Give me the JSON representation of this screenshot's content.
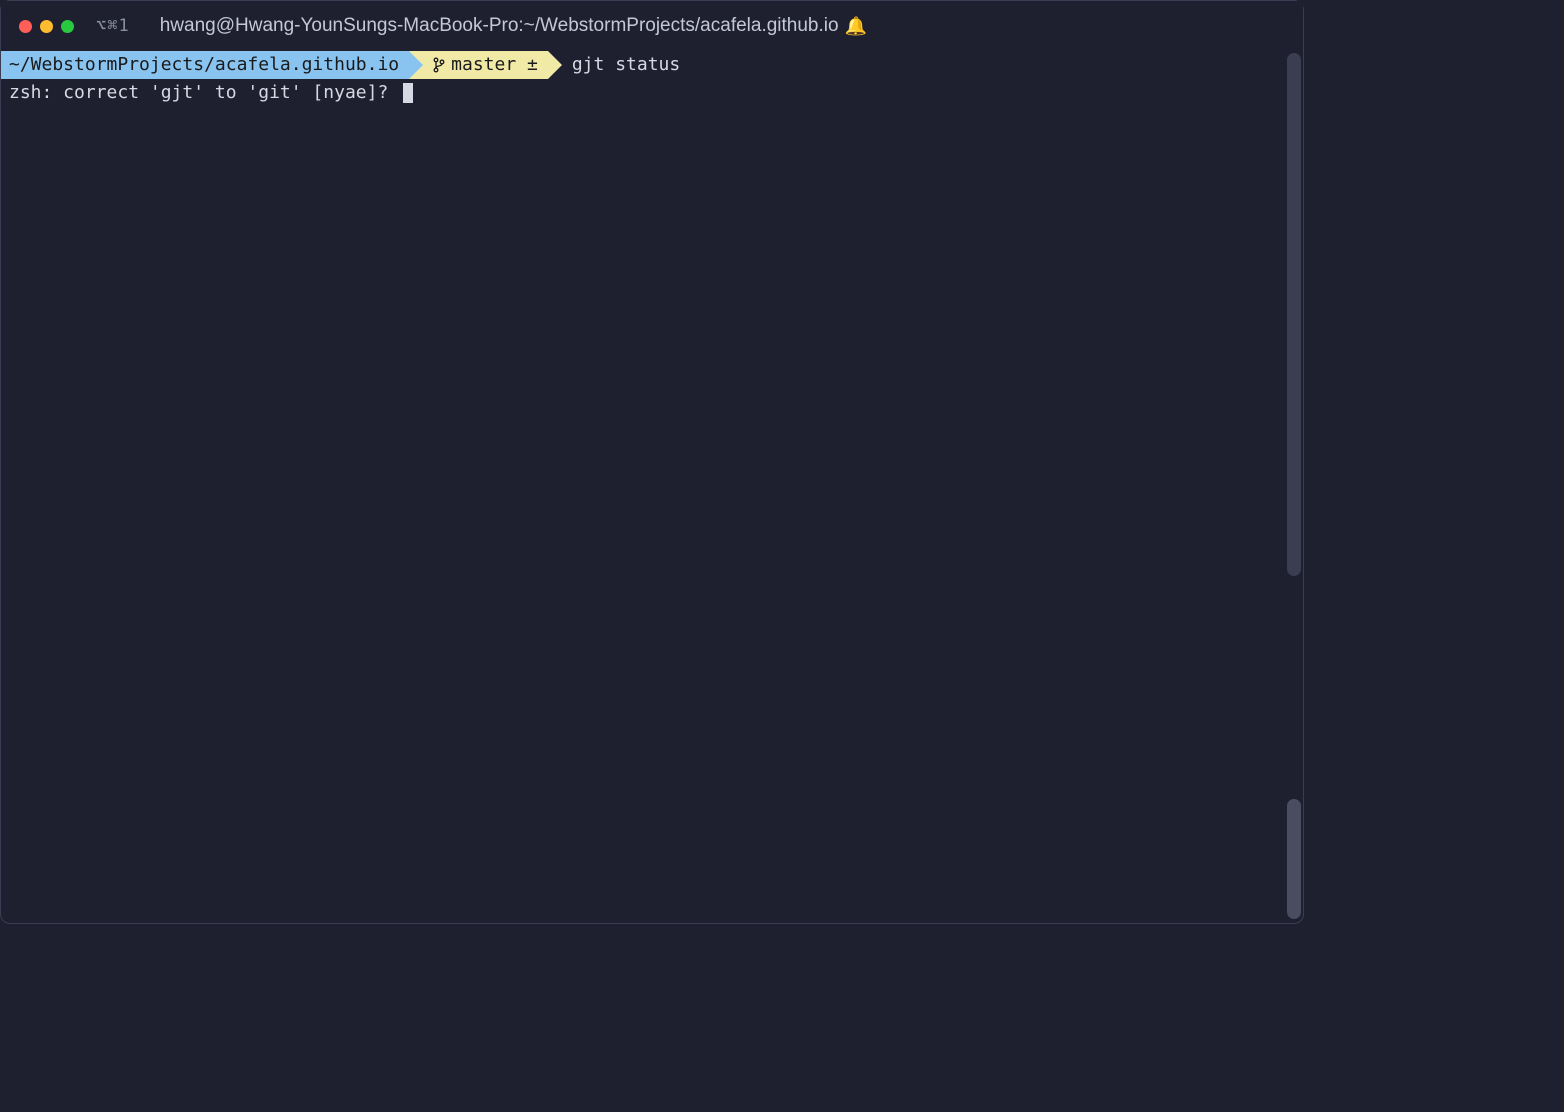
{
  "titlebar": {
    "shortcut": "⌥⌘1",
    "title": "hwang@Hwang-YounSungs-MacBook-Pro:~/WebstormProjects/acafela.github.io",
    "bell": "🔔"
  },
  "prompt": {
    "path": "~/WebstormProjects/acafela.github.io",
    "branch": "master ±",
    "command": "gjt status"
  },
  "output": {
    "line1": "zsh: correct 'gjt' to 'git' [nyae]? "
  }
}
